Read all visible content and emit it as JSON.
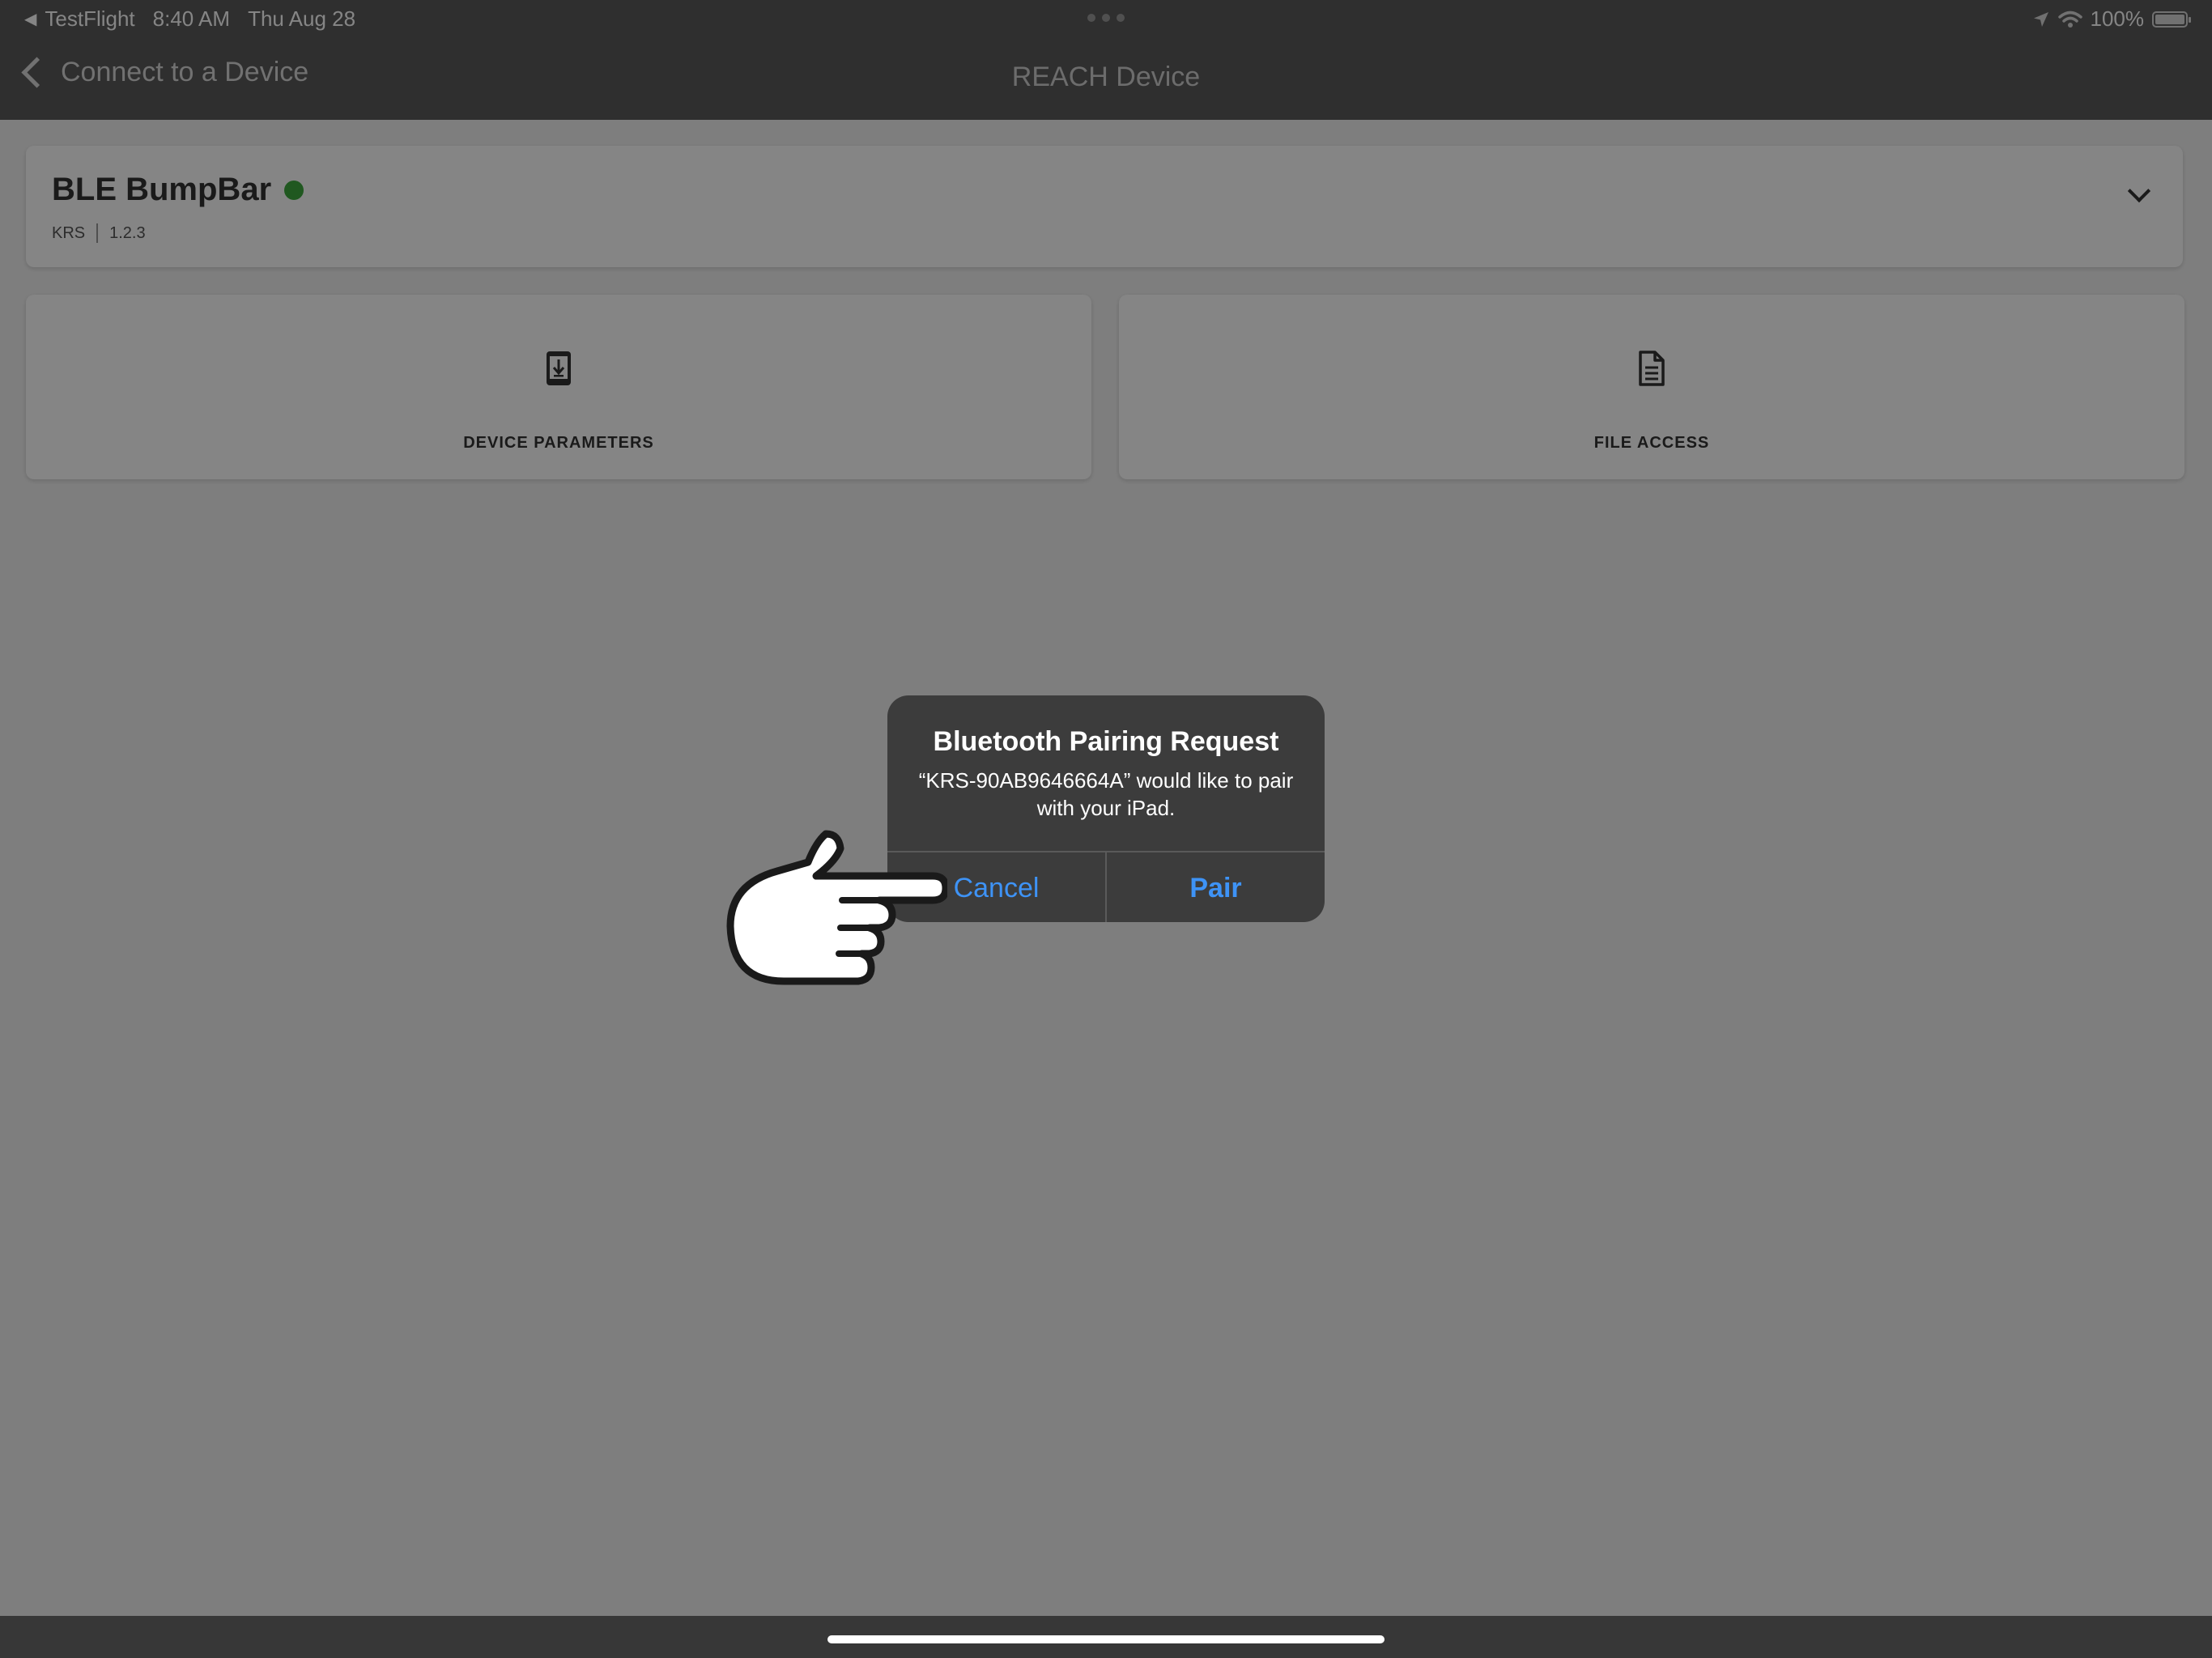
{
  "status_bar": {
    "back_app": "TestFlight",
    "time": "8:40 AM",
    "date": "Thu Aug 28",
    "battery": "100%"
  },
  "nav": {
    "back_label": "Connect to a Device",
    "title": "REACH Device"
  },
  "device": {
    "name": "BLE BumpBar",
    "vendor": "KRS",
    "version": "1.2.3",
    "status_color": "#3fa93f"
  },
  "tiles": [
    {
      "label": "DEVICE PARAMETERS",
      "icon": "phone-download-icon"
    },
    {
      "label": "FILE ACCESS",
      "icon": "document-icon"
    }
  ],
  "alert": {
    "title": "Bluetooth Pairing Request",
    "message": "“KRS-90AB9646664A” would like to pair with your iPad.",
    "cancel_label": "Cancel",
    "pair_label": "Pair",
    "button_color": "#3e93f6"
  },
  "annotation": {
    "icon": "pointing-hand-icon"
  }
}
